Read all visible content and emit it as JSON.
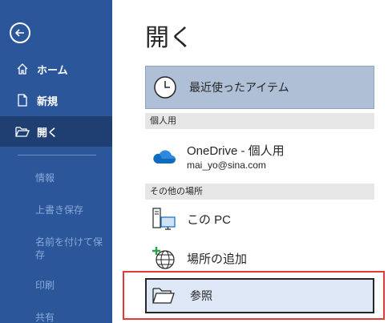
{
  "sidebar": {
    "items": [
      {
        "label": "ホーム",
        "icon": "home-icon"
      },
      {
        "label": "新規",
        "icon": "new-document-icon"
      },
      {
        "label": "開く",
        "icon": "open-folder-icon"
      }
    ],
    "disabled_items": [
      {
        "label": "情報"
      },
      {
        "label": "上書き保存"
      },
      {
        "label": "名前を付けて保存"
      },
      {
        "label": "印刷"
      },
      {
        "label": "共有"
      }
    ],
    "accent_color": "#2b579a",
    "active_color": "#1f3f73"
  },
  "main": {
    "title": "開く",
    "recent_label": "最近使ったアイテム",
    "sections": {
      "personal": "個人用",
      "other": "その他の場所"
    },
    "onedrive": {
      "name": "OneDrive - 個人用",
      "account": "mai_yo@sina.com"
    },
    "this_pc": "この PC",
    "add_place": "場所の追加",
    "browse": "参照"
  },
  "highlight_color": "#e53935"
}
